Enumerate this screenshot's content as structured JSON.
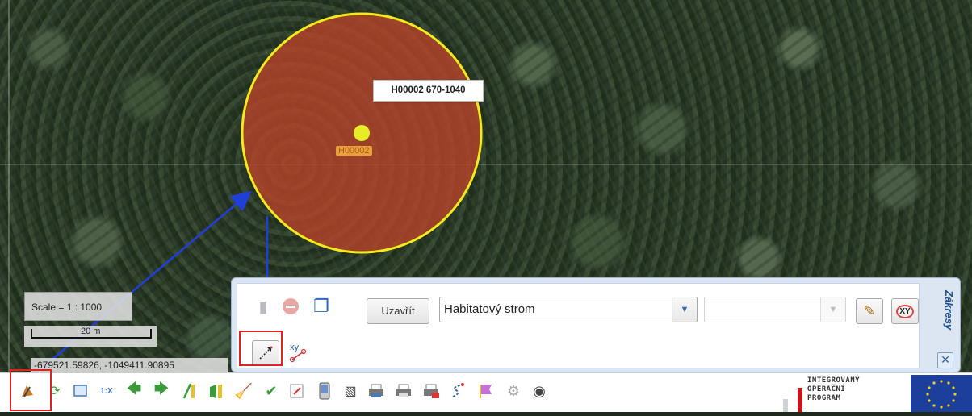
{
  "map": {
    "tree_id": "H00002",
    "popup_label": "H00002 670-1040",
    "scale_text": "Scale = 1 : 1000",
    "scale_bar_label": "20 m",
    "coordinates": "-679521.59826, -1049411.90895",
    "buffer_color": "#b5432a",
    "buffer_stroke": "#f2ea1c",
    "point_color": "#e6ec2a"
  },
  "edit_panel": {
    "close_button": "Uzavřít",
    "type_select_value": "Habitatový strom",
    "second_select_value": "",
    "side_tab": "Zákresy",
    "xy_delete_icon_text": "XY",
    "xy_add_icon_text": "xy",
    "close_x": "✕"
  },
  "toolbar": {
    "items": [
      "draw-tool-icon",
      "refresh-icon",
      "zoom-box-icon",
      "zoom-1x-icon",
      "back-icon",
      "forward-icon",
      "measure-line-icon",
      "measure-area-icon",
      "clear-icon",
      "select-icon",
      "export-icon",
      "pda-icon",
      "binoculars-icon",
      "print-icon",
      "print-2-icon",
      "print-pdf-icon",
      "route-icon",
      "flag-icon",
      "settings-icon",
      "eye-icon"
    ],
    "zoom_1x_text": "1:X"
  },
  "logo": {
    "lines": [
      "INTEGROVANÝ",
      "OPERAČNÍ",
      "PROGRAM"
    ]
  },
  "colors": {
    "highlight": "#e02222",
    "annotation_arrow": "#1f3fd8"
  }
}
